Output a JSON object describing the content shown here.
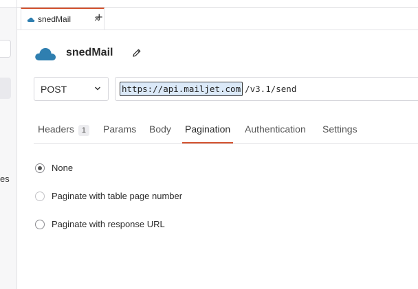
{
  "sidebar": {
    "partial_text": "es"
  },
  "tabs": [
    {
      "label": "snedMail",
      "close": "×"
    }
  ],
  "new_tab": "+",
  "request": {
    "title": "snedMail",
    "method": "POST",
    "url_host": "https://api.mailjet.com",
    "url_path": "/v3.1/send"
  },
  "subtabs": {
    "headers": "Headers",
    "headers_count": "1",
    "params": "Params",
    "body": "Body",
    "pagination": "Pagination",
    "authentication": "Authentication",
    "settings": "Settings",
    "active": "Pagination"
  },
  "pagination": {
    "options": [
      {
        "label": "None",
        "selected": true
      },
      {
        "label": "Paginate with table page number",
        "selected": false
      },
      {
        "label": "Paginate with response URL",
        "selected": false
      }
    ]
  },
  "colors": {
    "accent": "#d4532f",
    "cloud": "#2f7fb0"
  },
  "icons": {
    "request_icon": "cloud-icon",
    "edit": "pencil-icon",
    "method_dropdown": "chevron-down-icon"
  }
}
